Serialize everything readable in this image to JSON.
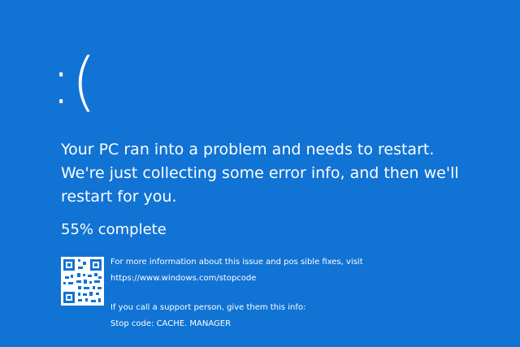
{
  "screen": {
    "sad_face": ":(",
    "message": "Your PC ran into a problem and needs to restart. We're just collecting some error info, and then we'll restart for you.",
    "progress": "55% complete"
  },
  "details": {
    "more_info_text": "For more information about this issue and pos sible fixes, visit",
    "url": "https://www.windows.com/stopcode",
    "support_text": "If you call a support person, give them this info:",
    "stop_code": "Stop code: CACHE. MANAGER"
  },
  "colors": {
    "background": "#1173d4",
    "text": "#ffffff"
  }
}
